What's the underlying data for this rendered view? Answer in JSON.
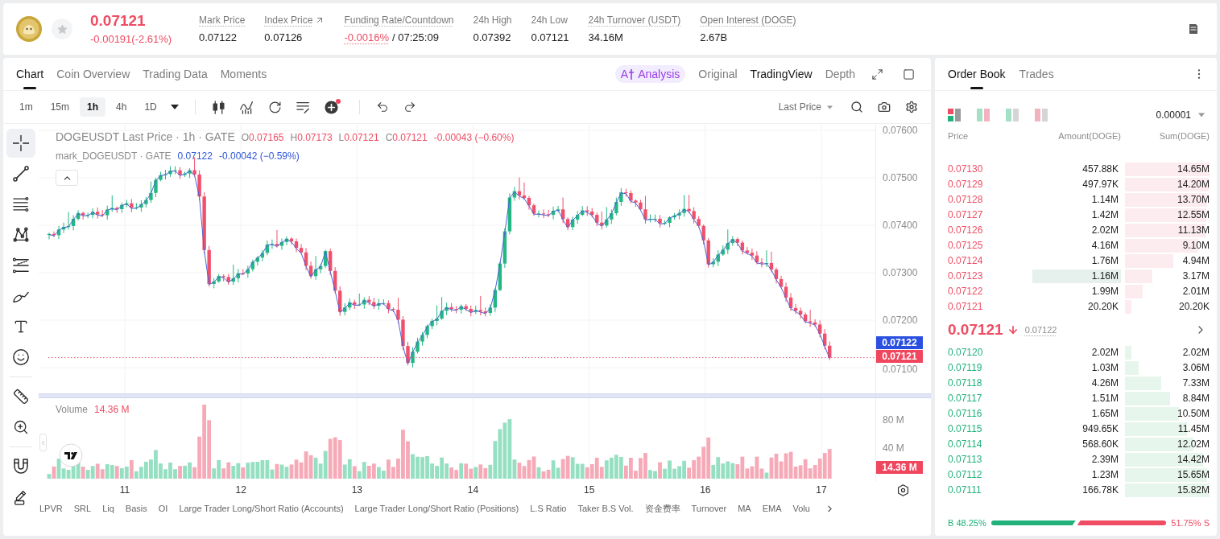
{
  "header": {
    "favorite": false,
    "price": "0.07121",
    "change": "-0.00191(-2.61%)",
    "stats": [
      {
        "kind": "plain",
        "label": "Mark Price",
        "underlined": true,
        "value": "0.07122"
      },
      {
        "kind": "link",
        "label": "Index Price",
        "underlined": true,
        "value": "0.07126"
      },
      {
        "kind": "funding",
        "label": "Funding Rate/Countdown",
        "underlined": true,
        "rate": "-0.0016%",
        "countdown": "/ 07:25:09"
      },
      {
        "kind": "plain",
        "label": "24h High",
        "underlined": false,
        "value": "0.07392"
      },
      {
        "kind": "plain",
        "label": "24h Low",
        "underlined": false,
        "value": "0.07121"
      },
      {
        "kind": "plain",
        "label": "24h Turnover (USDT)",
        "underlined": true,
        "value": "34.16M"
      },
      {
        "kind": "plain",
        "label": "Open Interest (DOGE)",
        "underlined": true,
        "value": "2.67B"
      }
    ]
  },
  "chart": {
    "tabs": [
      {
        "label": "Chart",
        "selected": true
      },
      {
        "label": "Coin Overview",
        "selected": false
      },
      {
        "label": "Trading Data",
        "selected": false
      },
      {
        "label": "Moments",
        "selected": false
      }
    ],
    "analysis": {
      "prefix": "A",
      "label": "Analysis"
    },
    "views": [
      {
        "label": "Original",
        "selected": false
      },
      {
        "label": "TradingView",
        "selected": true
      },
      {
        "label": "Depth",
        "selected": false
      }
    ],
    "intervals": [
      {
        "label": "1m",
        "selected": false
      },
      {
        "label": "15m",
        "selected": false
      },
      {
        "label": "1h",
        "selected": true
      },
      {
        "label": "4h",
        "selected": false
      },
      {
        "label": "1D",
        "selected": false
      }
    ],
    "toolbar_tools": [
      {
        "kind": "candles",
        "badge": false
      },
      {
        "kind": "indicators",
        "badge": false
      },
      {
        "kind": "replay",
        "badge": false
      },
      {
        "kind": "templates",
        "badge": false
      },
      {
        "kind": "add",
        "badge": true
      }
    ],
    "price_source": "Last Price",
    "drawing_tools": [
      [
        {
          "kind": "crosshair",
          "selected": true
        },
        {
          "kind": "trend_line",
          "selected": false
        },
        {
          "kind": "horizontal_lines",
          "selected": false
        },
        {
          "kind": "pattern",
          "selected": false
        },
        {
          "kind": "fib_lines",
          "selected": false
        },
        {
          "kind": "brush",
          "selected": false
        },
        {
          "kind": "text",
          "selected": false
        },
        {
          "kind": "emoji",
          "selected": false
        }
      ],
      [
        {
          "kind": "ruler",
          "selected": false
        },
        {
          "kind": "zoom",
          "selected": false
        }
      ],
      [
        {
          "kind": "magnet",
          "selected": false
        },
        {
          "kind": "pencil",
          "selected": false
        }
      ]
    ],
    "legend": {
      "title": "DOGEUSDT Last Price · 1h · GATE",
      "ohlc": [
        {
          "key": "O",
          "value": "0.07165"
        },
        {
          "key": "H",
          "value": "0.07173"
        },
        {
          "key": "L",
          "value": "0.07121"
        },
        {
          "key": "C",
          "value": "0.07121"
        }
      ],
      "change": "-0.00043 (−0.60%)",
      "mark_title": "mark_DOGEUSDT · GATE",
      "mark_value": "0.07122",
      "mark_change": "-0.00042 (−0.59%)"
    },
    "price_axis": [
      "0.07600",
      "0.07500",
      "0.07400",
      "0.07300",
      "0.07200",
      "0.07100"
    ],
    "mark_price_tag": "0.07122",
    "last_price_tag": "0.07121",
    "volume": {
      "label": "Volume",
      "value": "14.36 M",
      "axis": [
        "80 M",
        "40 M"
      ],
      "tag": "14.36 M"
    },
    "time_axis": [
      "11",
      "12",
      "13",
      "14",
      "15",
      "16",
      "17"
    ],
    "indicators": [
      "LPVR",
      "SRL",
      "Liq",
      "Basis",
      "OI",
      "Large Trader Long/Short Ratio (Accounts)",
      "Large Trader Long/Short Ratio (Positions)",
      "L.S Ratio",
      "Taker B.S Vol.",
      "资金费率",
      "Turnover",
      "MA",
      "EMA",
      "Volu"
    ]
  },
  "order_book": {
    "tabs": [
      {
        "label": "Order Book",
        "selected": true
      },
      {
        "label": "Trades",
        "selected": false
      }
    ],
    "layouts": [
      {
        "kind": "stacked",
        "selected": true
      },
      {
        "kind": "split",
        "selected": false
      },
      {
        "kind": "bids",
        "selected": false
      },
      {
        "kind": "asks",
        "selected": false
      }
    ],
    "precision": "0.00001",
    "columns": [
      "Price",
      "Amount(DOGE)",
      "Sum(DOGE)"
    ],
    "asks": [
      {
        "price": "0.07130",
        "amount": "457.88K",
        "sum": "14.65M",
        "level": 1.0,
        "highlighted": false
      },
      {
        "price": "0.07129",
        "amount": "497.97K",
        "sum": "14.20M",
        "level": 0.99,
        "highlighted": false
      },
      {
        "price": "0.07128",
        "amount": "1.14M",
        "sum": "13.70M",
        "level": 0.97,
        "highlighted": false
      },
      {
        "price": "0.07127",
        "amount": "1.42M",
        "sum": "12.55M",
        "level": 0.96,
        "highlighted": false
      },
      {
        "price": "0.07126",
        "amount": "2.02M",
        "sum": "11.13M",
        "level": 0.95,
        "highlighted": false
      },
      {
        "price": "0.07125",
        "amount": "4.16M",
        "sum": "9.10M",
        "level": 0.87,
        "highlighted": false
      },
      {
        "price": "0.07124",
        "amount": "1.76M",
        "sum": "4.94M",
        "level": 0.57,
        "highlighted": false
      },
      {
        "price": "0.07123",
        "amount": "1.16M",
        "sum": "3.17M",
        "level": 0.32,
        "highlighted": true
      },
      {
        "price": "0.07122",
        "amount": "1.99M",
        "sum": "2.01M",
        "level": 0.21,
        "highlighted": false
      },
      {
        "price": "0.07121",
        "amount": "20.20K",
        "sum": "20.20K",
        "level": 0.08,
        "highlighted": false
      }
    ],
    "last_price": "0.07121",
    "falling": true,
    "mark_price": "0.07122",
    "bids": [
      {
        "price": "0.07120",
        "amount": "2.02M",
        "sum": "2.02M",
        "level": 0.08,
        "highlighted": false
      },
      {
        "price": "0.07119",
        "amount": "1.03M",
        "sum": "3.06M",
        "level": 0.16,
        "highlighted": false
      },
      {
        "price": "0.07118",
        "amount": "4.26M",
        "sum": "7.33M",
        "level": 0.43,
        "highlighted": false
      },
      {
        "price": "0.07117",
        "amount": "1.51M",
        "sum": "8.84M",
        "level": 0.53,
        "highlighted": false
      },
      {
        "price": "0.07116",
        "amount": "1.65M",
        "sum": "10.50M",
        "level": 0.64,
        "highlighted": false
      },
      {
        "price": "0.07115",
        "amount": "949.65K",
        "sum": "11.45M",
        "level": 0.73,
        "highlighted": false
      },
      {
        "price": "0.07114",
        "amount": "568.60K",
        "sum": "12.02M",
        "level": 0.81,
        "highlighted": false
      },
      {
        "price": "0.07113",
        "amount": "2.39M",
        "sum": "14.42M",
        "level": 0.92,
        "highlighted": false
      },
      {
        "price": "0.07112",
        "amount": "1.23M",
        "sum": "15.65M",
        "level": 0.97,
        "highlighted": false
      },
      {
        "price": "0.07111",
        "amount": "166.78K",
        "sum": "15.82M",
        "level": 1.0,
        "highlighted": false
      }
    ],
    "ratio": {
      "buy": "B 48.25%",
      "sell": "51.75% S",
      "level": 0.4825
    }
  }
}
